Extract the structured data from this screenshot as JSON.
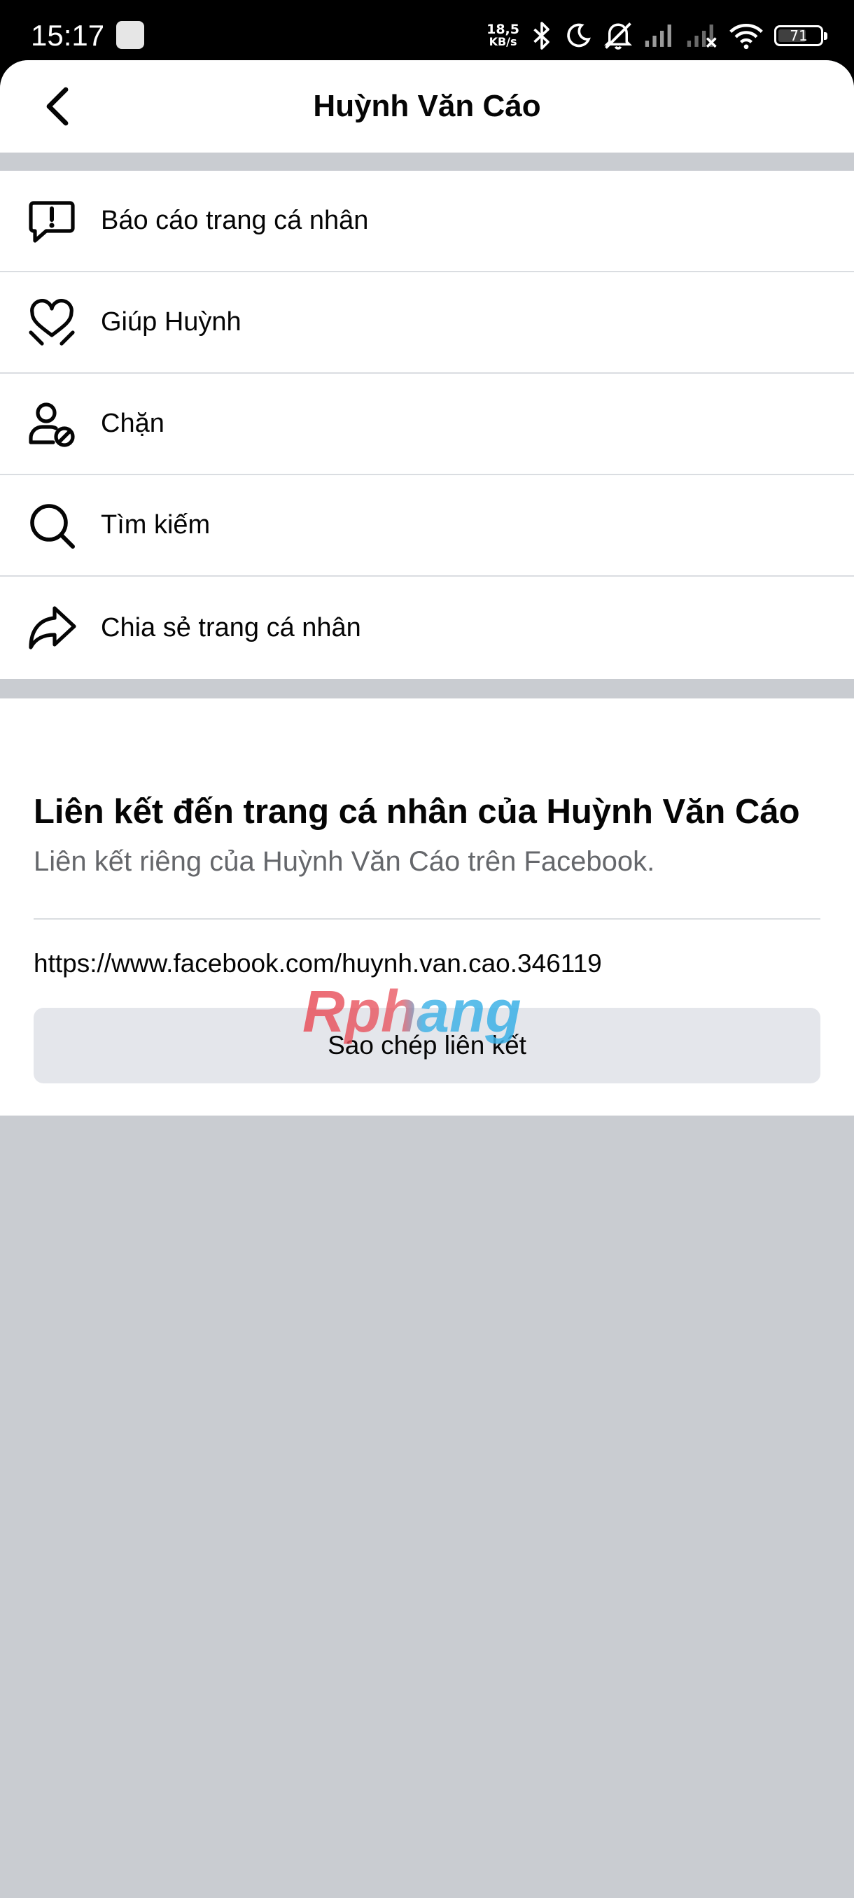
{
  "status_bar": {
    "time": "15:17",
    "net_speed_value": "18,5",
    "net_speed_unit": "KB/s",
    "battery_level": "71",
    "battery_fraction": 0.71
  },
  "header": {
    "title": "Huỳnh Văn Cáo"
  },
  "menu": {
    "items": [
      {
        "label": "Báo cáo trang cá nhân",
        "icon": "report-icon"
      },
      {
        "label": "Giúp Huỳnh",
        "icon": "heart-hand-icon"
      },
      {
        "label": "Chặn",
        "icon": "block-user-icon"
      },
      {
        "label": "Tìm kiếm",
        "icon": "search-icon"
      },
      {
        "label": "Chia sẻ trang cá nhân",
        "icon": "share-icon"
      }
    ]
  },
  "link_card": {
    "title": "Liên kết đến trang cá nhân của Huỳnh Văn Cáo",
    "subtitle": "Liên kết riêng của Huỳnh Văn Cáo trên Facebook.",
    "url": "https://www.facebook.com/huynh.van.cao.346119",
    "copy_label": "Sao chép liên kết"
  },
  "watermark": {
    "text": "Rphang"
  },
  "colors": {
    "background_gray": "#c9ccd1",
    "button_gray": "#e4e6eb",
    "secondary_text": "#65676b",
    "divider": "#dadde1"
  }
}
